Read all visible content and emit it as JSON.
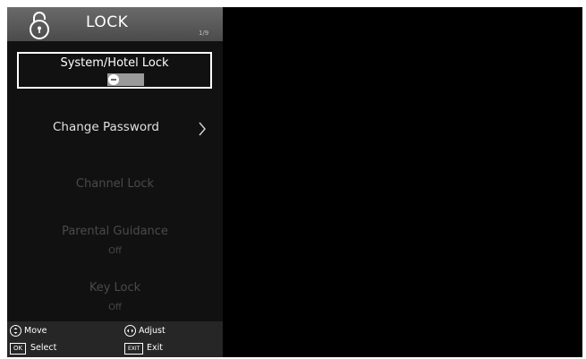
{
  "header": {
    "title": "LOCK",
    "page_indicator": "1/9",
    "icon": "padlock-icon"
  },
  "menu": {
    "system_hotel_lock": {
      "label": "System/Hotel Lock",
      "toggle_state": "off"
    },
    "change_password": {
      "label": "Change Password",
      "icon": "chevron-right-icon"
    },
    "channel_lock": {
      "label": "Channel Lock"
    },
    "parental_guidance": {
      "label": "Parental Guidance",
      "value": "Off"
    },
    "key_lock": {
      "label": "Key Lock",
      "value": "Off"
    }
  },
  "footer": {
    "move_label": "Move",
    "adjust_label": "Adjust",
    "ok_key": "OK",
    "select_label": "Select",
    "exit_key": "EXIT",
    "exit_label": "Exit"
  },
  "colors": {
    "panel_bg": "#111111",
    "header_bg": "#555555",
    "footer_bg": "#262626",
    "dim_text": "#4a4a4a",
    "screen_bg": "#000000"
  }
}
